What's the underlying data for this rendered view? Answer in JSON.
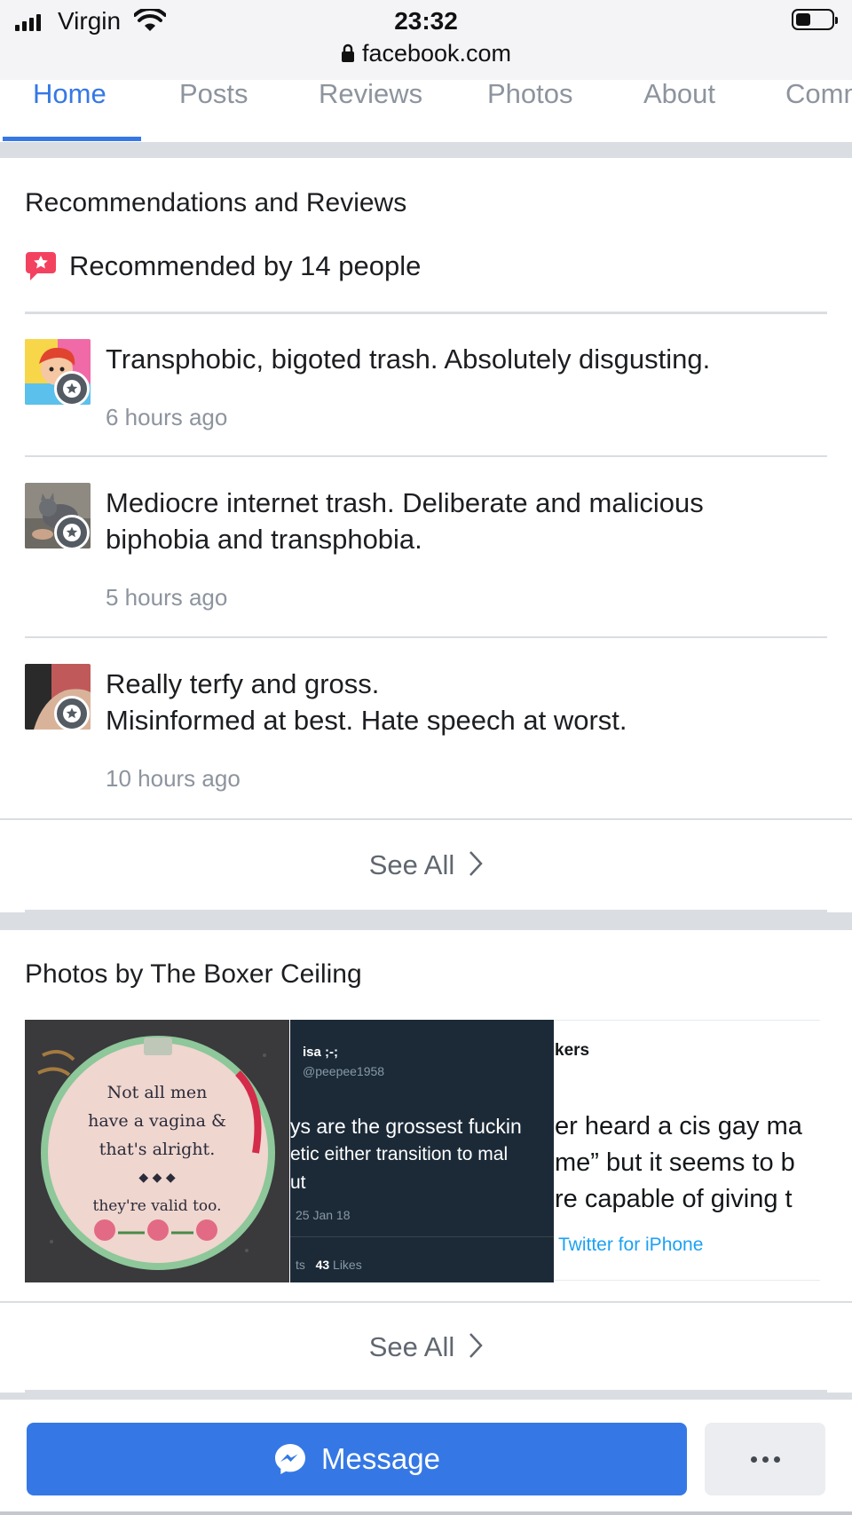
{
  "status_bar": {
    "carrier": "Virgin",
    "time": "23:32",
    "url": "facebook.com"
  },
  "tabs": [
    {
      "label": "Home",
      "active": true
    },
    {
      "label": "Posts",
      "active": false
    },
    {
      "label": "Reviews",
      "active": false
    },
    {
      "label": "Photos",
      "active": false
    },
    {
      "label": "About",
      "active": false
    },
    {
      "label": "Comm",
      "active": false
    }
  ],
  "recommendations": {
    "title": "Recommendations and Reviews",
    "summary": "Recommended by 14 people",
    "reviews": [
      {
        "text_lines": [
          "Transphobic, bigoted trash. Absolutely disgusting."
        ],
        "time": "6 hours ago"
      },
      {
        "text_lines": [
          "Mediocre internet trash. Deliberate and malicious",
          "biphobia and transphobia."
        ],
        "time": "5 hours ago"
      },
      {
        "text_lines": [
          "Really terfy and gross.",
          "Misinformed at best. Hate speech at worst."
        ],
        "time": "10 hours ago"
      }
    ],
    "see_all": "See All"
  },
  "photos": {
    "title": "Photos by The Boxer Ceiling",
    "see_all": "See All",
    "photo1_lines": [
      "Not all men",
      "have a vagina &",
      "that's alright.",
      "◆ ◆ ◆",
      "they're valid too."
    ],
    "photo2": {
      "name": "isa ;-;",
      "handle": "@peepee1958",
      "lines": [
        "ys are the grossest fuckin",
        "etic either transition to mal",
        "ut"
      ],
      "date": "25 Jan 18",
      "stats_prefix": "ts",
      "likes_count": "43",
      "likes_label": "Likes"
    },
    "photo3": {
      "header": "kers",
      "lines": [
        "er heard a cis gay ma",
        "me” but it seems to b",
        "re capable of giving t"
      ],
      "source": "Twitter for iPhone"
    }
  },
  "actions": {
    "message_label": "Message",
    "colors": {
      "primary": "#3578e5",
      "secondary_bg": "#ebedf0"
    }
  }
}
